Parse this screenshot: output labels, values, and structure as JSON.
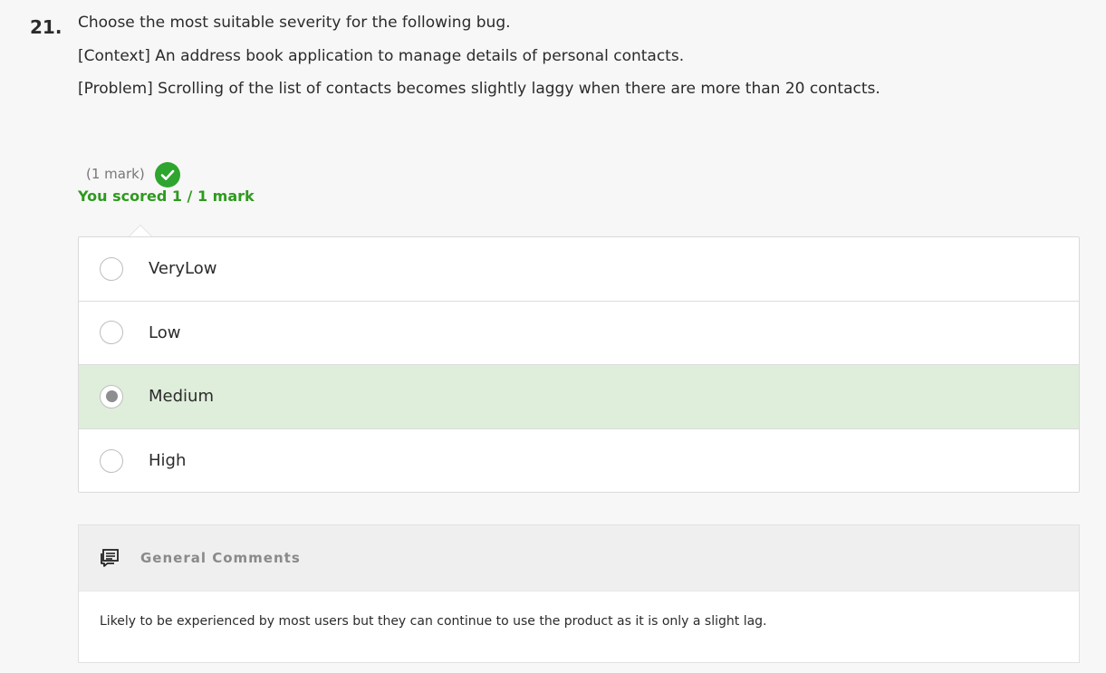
{
  "question": {
    "number": "21.",
    "lines": [
      "Choose the most suitable severity for the following bug.",
      "[Context] An address book application to manage details of personal contacts.",
      "[Problem] Scrolling of the list of contacts becomes slightly laggy when there are more than 20 contacts."
    ]
  },
  "marks": {
    "label": "(1 mark)",
    "score_text": "You scored 1 / 1 mark",
    "status_icon": "check-circle-icon",
    "status_color": "#2ea52e"
  },
  "options": [
    {
      "label": "VeryLow",
      "selected": false
    },
    {
      "label": "Low",
      "selected": false
    },
    {
      "label": "Medium",
      "selected": true
    },
    {
      "label": "High",
      "selected": false
    }
  ],
  "comments": {
    "icon": "comments-icon",
    "title": "General Comments",
    "body": "Likely to be experienced by most users but they can continue to use the product as it is only a slight lag."
  },
  "colors": {
    "selected_background": "#dfeedb",
    "score_text": "#2e9a1e"
  }
}
